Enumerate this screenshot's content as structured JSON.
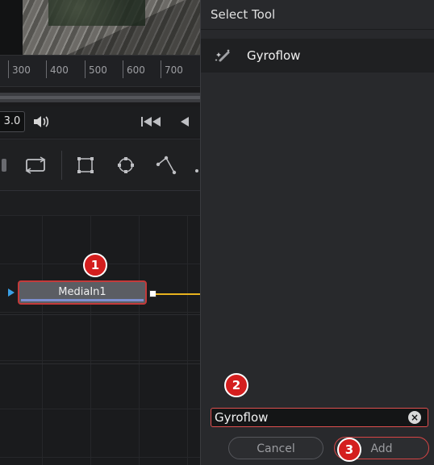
{
  "ruler": {
    "ticks": [
      "300",
      "400",
      "500",
      "600",
      "700"
    ]
  },
  "controls": {
    "fps": "3.0"
  },
  "node": {
    "name": "MediaIn1"
  },
  "dialog": {
    "title": "Select Tool",
    "items": [
      {
        "label": "Gyroflow"
      }
    ],
    "search_value": "Gyroflow",
    "cancel_label": "Cancel",
    "add_label": "Add"
  },
  "badges": {
    "b1": "1",
    "b2": "2",
    "b3": "3"
  },
  "colors": {
    "annotation": "#d41e1e",
    "wire": "#e8b31e",
    "node_bar": "#7e8fd0"
  }
}
